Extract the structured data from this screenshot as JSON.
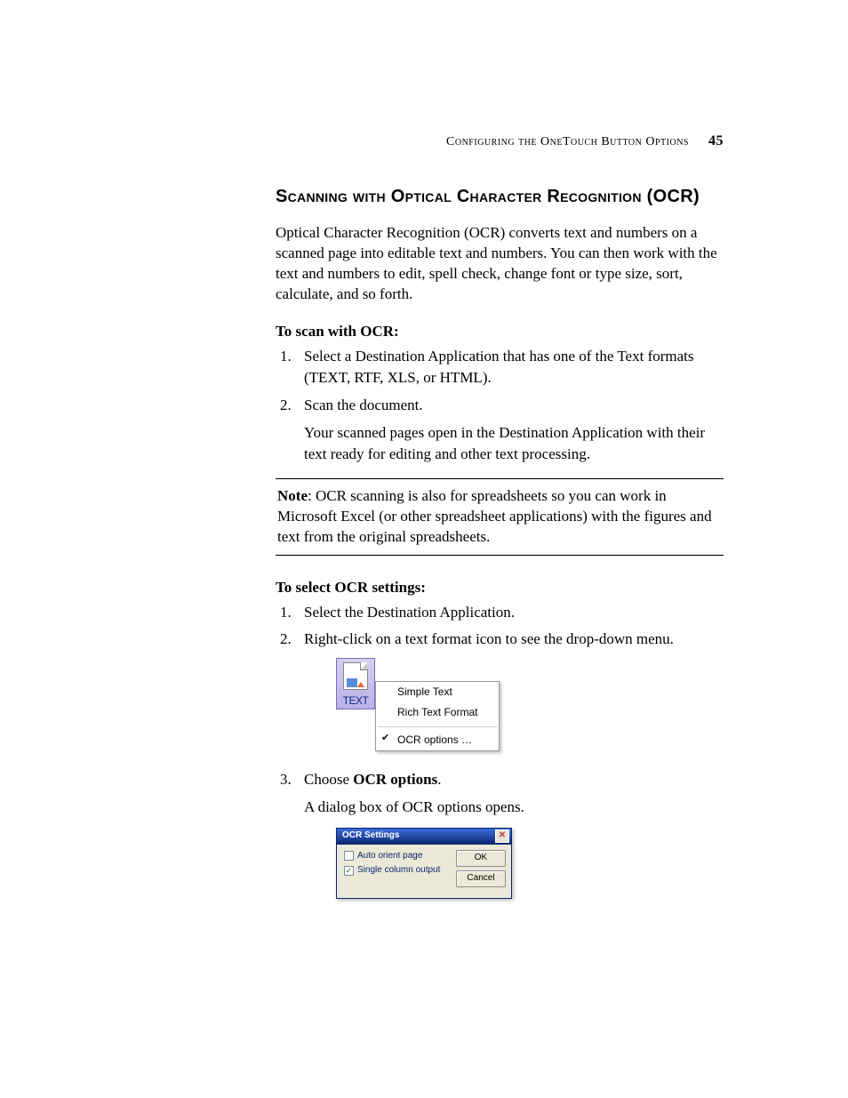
{
  "header": {
    "running_head": "Configuring the OneTouch Button Options",
    "page_number": "45"
  },
  "section": {
    "title": "Scanning with Optical Character Recognition (OCR)",
    "intro": "Optical Character Recognition (OCR) converts text and numbers on a scanned page into editable text and numbers. You can then work with the text and numbers to edit, spell check, change font or type size, sort, calculate, and so forth.",
    "sub1_title": "To scan with OCR:",
    "steps1": {
      "s1": "Select a Destination Application that has one of the Text formats (TEXT, RTF, XLS, or HTML).",
      "s2": "Scan the document.",
      "s2_follow": "Your scanned pages open in the Destination Application with their text ready for editing and other text processing."
    },
    "note_label": "Note",
    "note_body": ":  OCR scanning is also for spreadsheets so you can work in Microsoft Excel (or other spreadsheet applications) with the figures and text from the original spreadsheets.",
    "sub2_title": "To select OCR settings:",
    "steps2": {
      "s1": "Select the Destination Application.",
      "s2": "Right-click on a text format icon to see the drop-down menu.",
      "s3_pre": "Choose ",
      "s3_bold": "OCR options",
      "s3_post": ".",
      "s3_follow": "A dialog box of OCR options opens."
    }
  },
  "menu": {
    "icon_label": "TEXT",
    "item1": "Simple Text",
    "item2": "Rich Text Format",
    "item3": "OCR options …"
  },
  "dialog": {
    "title": "OCR Settings",
    "opt1": "Auto orient page",
    "opt2": "Single column output",
    "ok": "OK",
    "cancel": "Cancel",
    "close_glyph": "✕"
  }
}
